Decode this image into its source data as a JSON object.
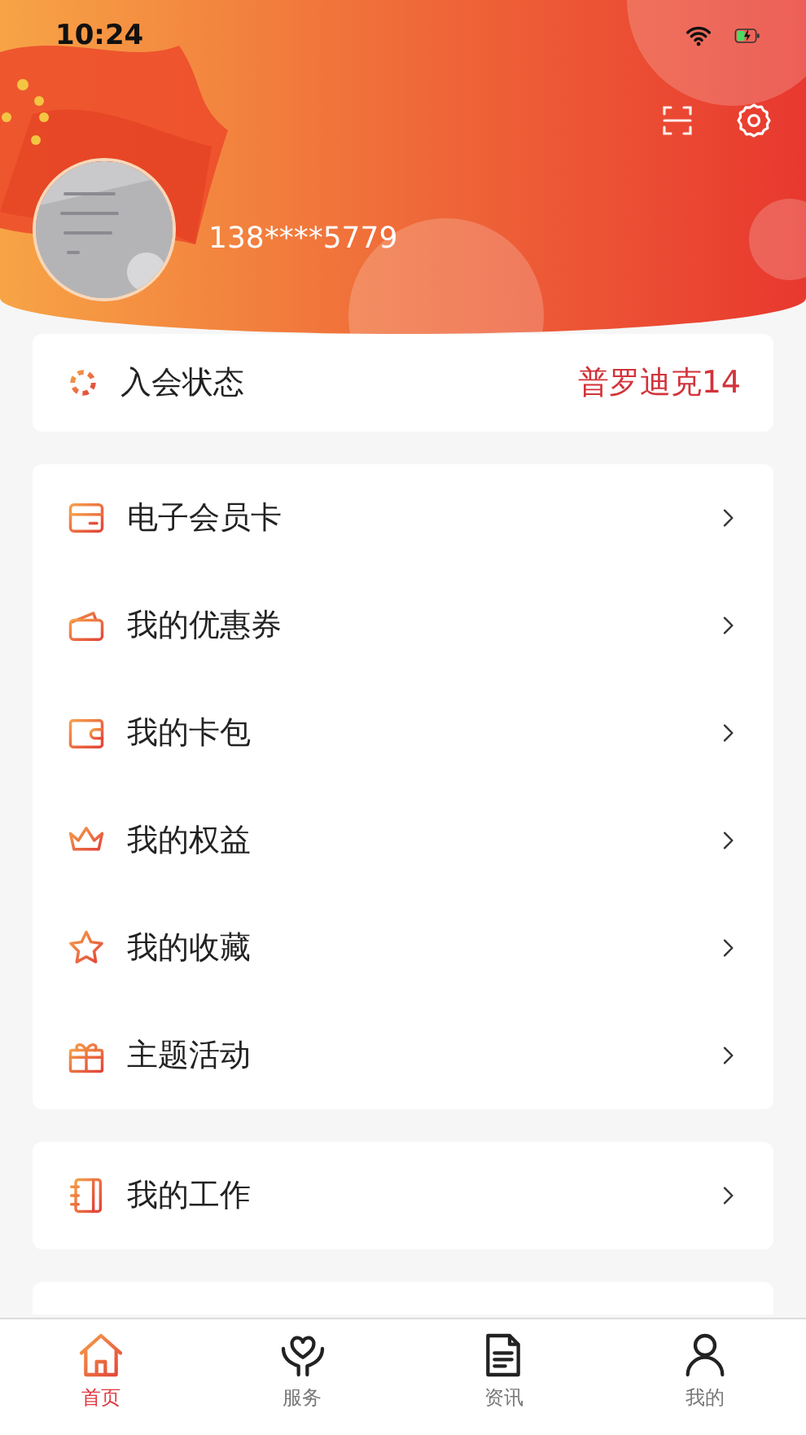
{
  "status_bar": {
    "time": "10:24"
  },
  "profile": {
    "phone": "138****5779"
  },
  "membership": {
    "label": "入会状态",
    "value": "普罗迪克14"
  },
  "menu_groups": [
    [
      {
        "label": "电子会员卡"
      },
      {
        "label": "我的优惠券"
      },
      {
        "label": "我的卡包"
      },
      {
        "label": "我的权益"
      },
      {
        "label": "我的收藏"
      },
      {
        "label": "主题活动"
      }
    ],
    [
      {
        "label": "我的工作"
      }
    ]
  ],
  "tab_bar": [
    {
      "label": "首页",
      "selected": true
    },
    {
      "label": "服务",
      "selected": false
    },
    {
      "label": "资讯",
      "selected": false
    },
    {
      "label": "我的",
      "selected": false
    }
  ]
}
